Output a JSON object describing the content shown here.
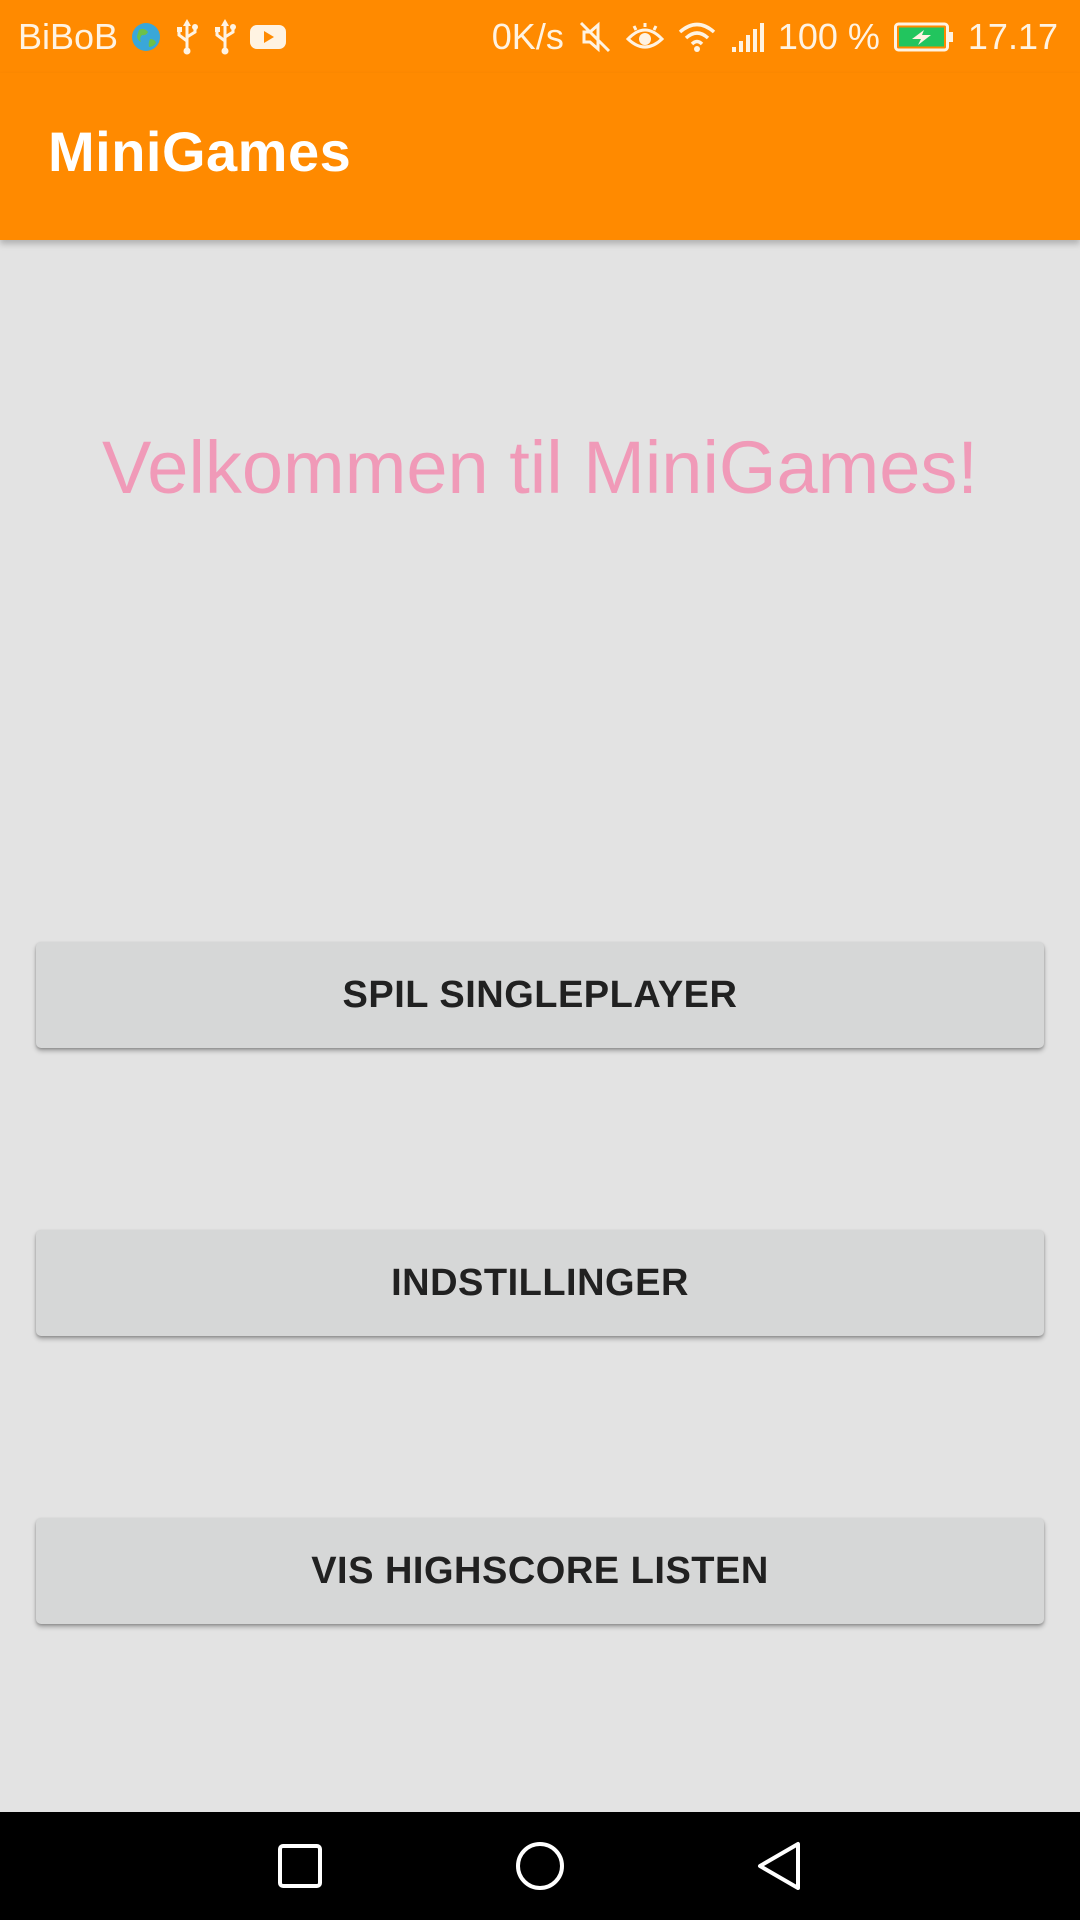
{
  "status_bar": {
    "carrier": "BiBoB",
    "speed": "0K/s",
    "battery_percent": "100 %",
    "time": "17.17",
    "icons_left": [
      "globe-icon",
      "usb-icon",
      "usb-icon",
      "youtube-icon"
    ],
    "icons_right": [
      "mute-icon",
      "eye-icon",
      "wifi-icon",
      "signal-icon",
      "battery-charging-icon"
    ]
  },
  "toolbar": {
    "title": "MiniGames"
  },
  "main": {
    "welcome": "Velkommen til MiniGames!",
    "buttons": [
      {
        "label": "SPIL SINGLEPLAYER"
      },
      {
        "label": "INDSTILLINGER"
      },
      {
        "label": "VIS HIGHSCORE LISTEN"
      }
    ]
  },
  "nav_bar": {
    "icons": [
      "recent-apps-icon",
      "home-icon",
      "back-icon"
    ]
  },
  "colors": {
    "accent": "#ff8a00",
    "welcome_text": "#f09ab8",
    "background": "#e3e3e3",
    "button": "#d6d7d7",
    "battery": "#22c55e"
  }
}
